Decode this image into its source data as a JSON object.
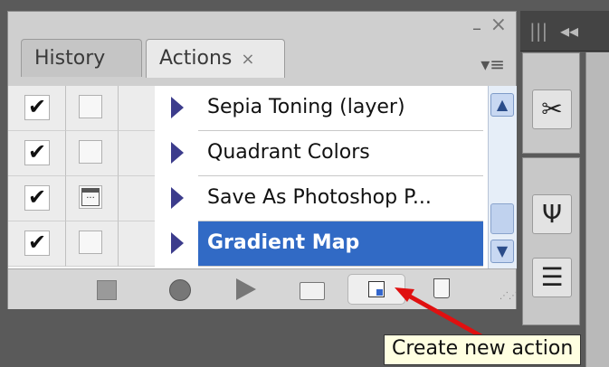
{
  "tabs": [
    {
      "label": "History",
      "active": false
    },
    {
      "label": "Actions",
      "active": true,
      "close_glyph": "×"
    }
  ],
  "window_controls": {
    "minimize": "–",
    "close": "×",
    "menu": "▾≡"
  },
  "actions": [
    {
      "label": "Sepia Toning (layer)",
      "checked": true,
      "dialog": false,
      "selected": false
    },
    {
      "label": "Quadrant Colors",
      "checked": true,
      "dialog": false,
      "selected": false
    },
    {
      "label": "Save As Photoshop P...",
      "checked": true,
      "dialog": true,
      "selected": false
    },
    {
      "label": "Gradient Map",
      "checked": true,
      "dialog": false,
      "selected": true
    }
  ],
  "check_glyph": "✔",
  "scroll": {
    "up": "▲",
    "down": "▼"
  },
  "toolbar": {
    "buttons": [
      "stop-icon",
      "record-icon",
      "play-icon",
      "folder-icon",
      "new-action-icon",
      "trash-icon"
    ]
  },
  "tooltip": {
    "text": "Create new action"
  },
  "dock": {
    "grip": "|||",
    "collapse": "◂◂"
  },
  "colors": {
    "selection": "#316ac5",
    "annotation_arrow": "#e01010",
    "tooltip_bg": "#ffffe1"
  }
}
